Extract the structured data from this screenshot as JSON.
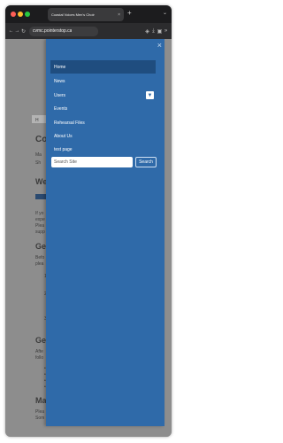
{
  "browser": {
    "tab_title": "Coastal Voices Men's Choir",
    "tab_close": "×",
    "new_tab": "+",
    "tab_menu": "⌄",
    "url": "cvmc.pointerstop.ca",
    "icons": [
      "back-icon",
      "forward-icon",
      "reload-icon",
      "shield-icon",
      "download-icon",
      "extensions-icon",
      "menu-icon"
    ]
  },
  "background_page": {
    "texts": [
      "H",
      "Co",
      "Ma",
      "Sh",
      "We",
      "Le",
      "If yo",
      "expe",
      "Plea",
      "supp",
      "Ge",
      "Befo",
      "plea",
      "1.",
      "2.",
      "3.",
      "Ge",
      "Afte",
      "follo",
      "•",
      "•",
      "•",
      "•",
      "Ma",
      "Plea",
      "Som"
    ]
  },
  "menu": {
    "close_label": "×",
    "items": [
      {
        "label": "Home"
      },
      {
        "label": "News"
      },
      {
        "label": "Users",
        "expand_icon": "▼"
      },
      {
        "label": "Events"
      },
      {
        "label": "Rehearsal Files"
      },
      {
        "label": "About Us"
      },
      {
        "label": "test page"
      }
    ],
    "search": {
      "placeholder": "Search Site",
      "button_label": "Search"
    }
  },
  "colors": {
    "menu_bg": "#2f6aa9",
    "active_item": "#1f4d7f",
    "overlay": "#8d8d8d"
  }
}
